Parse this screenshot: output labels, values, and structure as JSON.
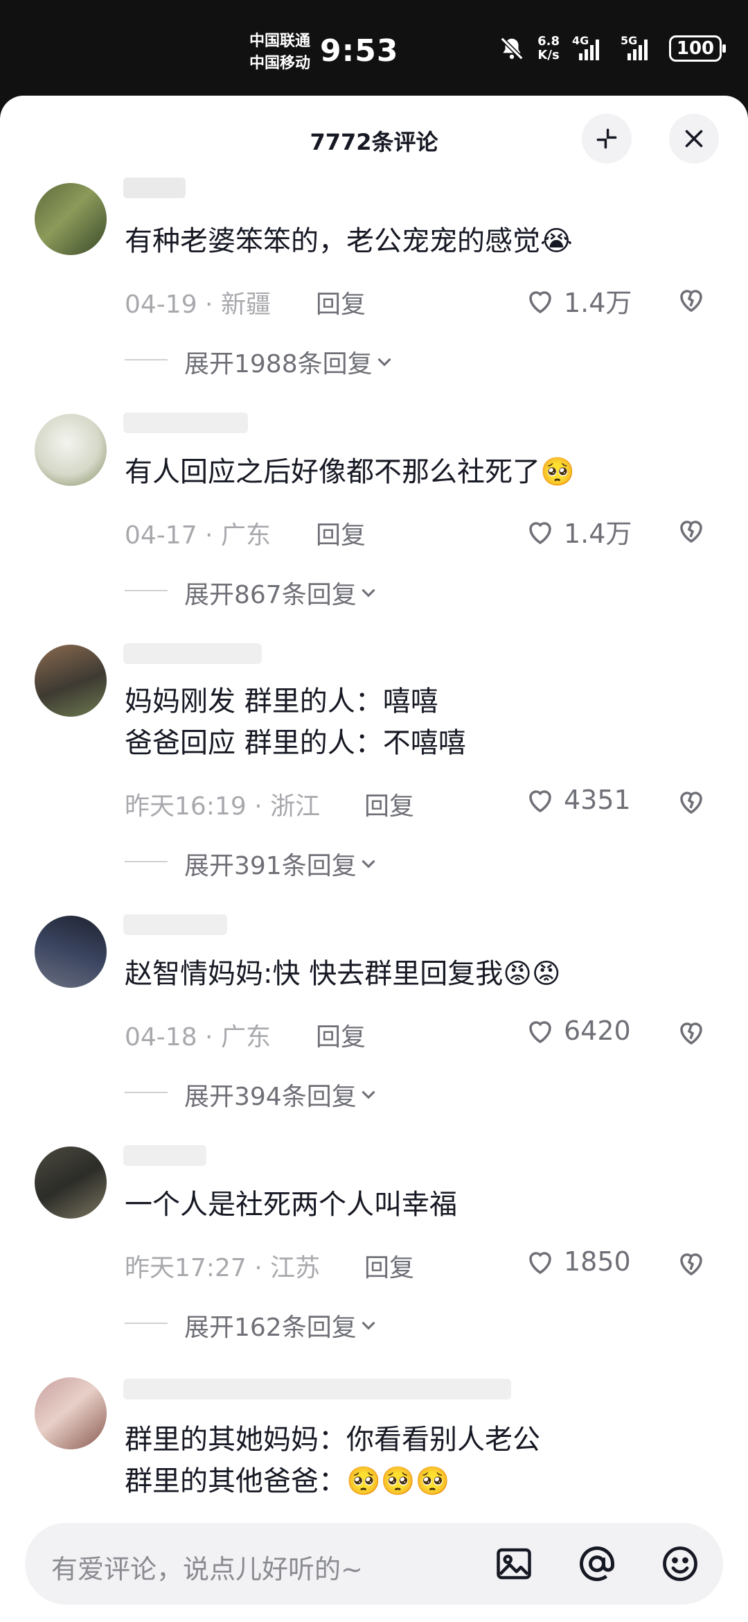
{
  "status_bar": {
    "carrier_1": "中国联通",
    "carrier_2": "中国移动",
    "time": "9:53",
    "net_speed_value": "6.8",
    "net_speed_unit": "K/s",
    "signal_1_label": "4G",
    "signal_2_label": "5G",
    "battery": "100"
  },
  "sheet": {
    "title": "7772条评论"
  },
  "comments": [
    {
      "text": "有种老婆笨笨的，老公宠宠的感觉",
      "emoji": "😭",
      "date": "04-19",
      "location": "新疆",
      "reply_label": "回复",
      "likes": "1.4万",
      "expand": "展开1988条回复"
    },
    {
      "text": "有人回应之后好像都不那么社死了",
      "emoji": "🥺",
      "date": "04-17",
      "location": "广东",
      "reply_label": "回复",
      "likes": "1.4万",
      "expand": "展开867条回复"
    },
    {
      "text": "妈妈刚发 群里的人：嘻嘻\n爸爸回应 群里的人：不嘻嘻",
      "emoji": "",
      "date": "昨天16:19",
      "location": "浙江",
      "reply_label": "回复",
      "likes": "4351",
      "expand": "展开391条回复"
    },
    {
      "text": "赵智情妈妈:快 快去群里回复我",
      "emoji": "😡😡",
      "date": "04-18",
      "location": "广东",
      "reply_label": "回复",
      "likes": "6420",
      "expand": "展开394条回复"
    },
    {
      "text": "一个人是社死两个人叫幸福",
      "emoji": "",
      "date": "昨天17:27",
      "location": "江苏",
      "reply_label": "回复",
      "likes": "1850",
      "expand": "展开162条回复"
    },
    {
      "text": "群里的其她妈妈：你看看别人老公\n群里的其他爸爸：",
      "emoji": "🥺🥺🥺"
    }
  ],
  "input": {
    "placeholder": "有爱评论，说点儿好听的~"
  },
  "icons": {
    "collapse": "collapse-icon",
    "close": "close-icon",
    "like": "heart-icon",
    "dislike": "broken-heart-icon",
    "chevron": "chevron-down-icon",
    "image": "image-icon",
    "mention": "at-icon",
    "emoji": "emoji-icon",
    "mute": "bell-off-icon"
  }
}
